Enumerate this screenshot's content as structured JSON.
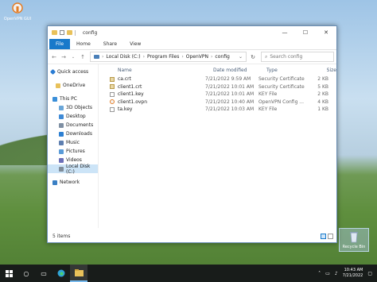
{
  "desktop": {
    "icons": [
      {
        "label": "OpenVPN GUI"
      },
      {
        "label": "Recycle Bin"
      }
    ]
  },
  "window": {
    "title": "config",
    "controls": {
      "minimize": "—",
      "maximize": "☐",
      "close": "✕"
    },
    "ribbon_tabs": [
      "File",
      "Home",
      "Share",
      "View"
    ],
    "breadcrumbs": [
      "Local Disk (C:)",
      "Program Files",
      "OpenVPN",
      "config"
    ],
    "search_placeholder": "Search config",
    "nav": [
      {
        "label": "Quick access",
        "color": "#2b7cd3"
      },
      {
        "label": "OneDrive",
        "color": "#2b7cd3"
      },
      {
        "label": "This PC",
        "color": "#3a8fd9"
      },
      {
        "label": "3D Objects",
        "color": "#6aa6d8"
      },
      {
        "label": "Desktop",
        "color": "#3e8ad6"
      },
      {
        "label": "Documents",
        "color": "#7e8fa3"
      },
      {
        "label": "Downloads",
        "color": "#2c7fd2"
      },
      {
        "label": "Music",
        "color": "#5e7fb0"
      },
      {
        "label": "Pictures",
        "color": "#5a9bd8"
      },
      {
        "label": "Videos",
        "color": "#6b6fb8"
      },
      {
        "label": "Local Disk (C:)",
        "color": "#7f8c99"
      },
      {
        "label": "Network",
        "color": "#3a7fc4"
      }
    ],
    "columns": {
      "name": "Name",
      "date": "Date modified",
      "type": "Type",
      "size": "Size"
    },
    "files": [
      {
        "name": "ca.crt",
        "date": "7/21/2022 9:59 AM",
        "type": "Security Certificate",
        "size": "2 KB",
        "icon": "certificate-icon"
      },
      {
        "name": "client1.crt",
        "date": "7/21/2022 10:01 AM",
        "type": "Security Certificate",
        "size": "5 KB",
        "icon": "certificate-icon"
      },
      {
        "name": "client1.key",
        "date": "7/21/2022 10:01 AM",
        "type": "KEY File",
        "size": "2 KB",
        "icon": "file-icon"
      },
      {
        "name": "client1.ovpn",
        "date": "7/21/2022 10:40 AM",
        "type": "OpenVPN Config ...",
        "size": "4 KB",
        "icon": "openvpn-config-icon"
      },
      {
        "name": "ta.key",
        "date": "7/21/2022 10:03 AM",
        "type": "KEY File",
        "size": "1 KB",
        "icon": "file-icon"
      }
    ],
    "status": "5 items"
  },
  "taskbar": {
    "time": "10:43 AM",
    "date": "7/21/2022",
    "accent": "#76b9ed"
  }
}
